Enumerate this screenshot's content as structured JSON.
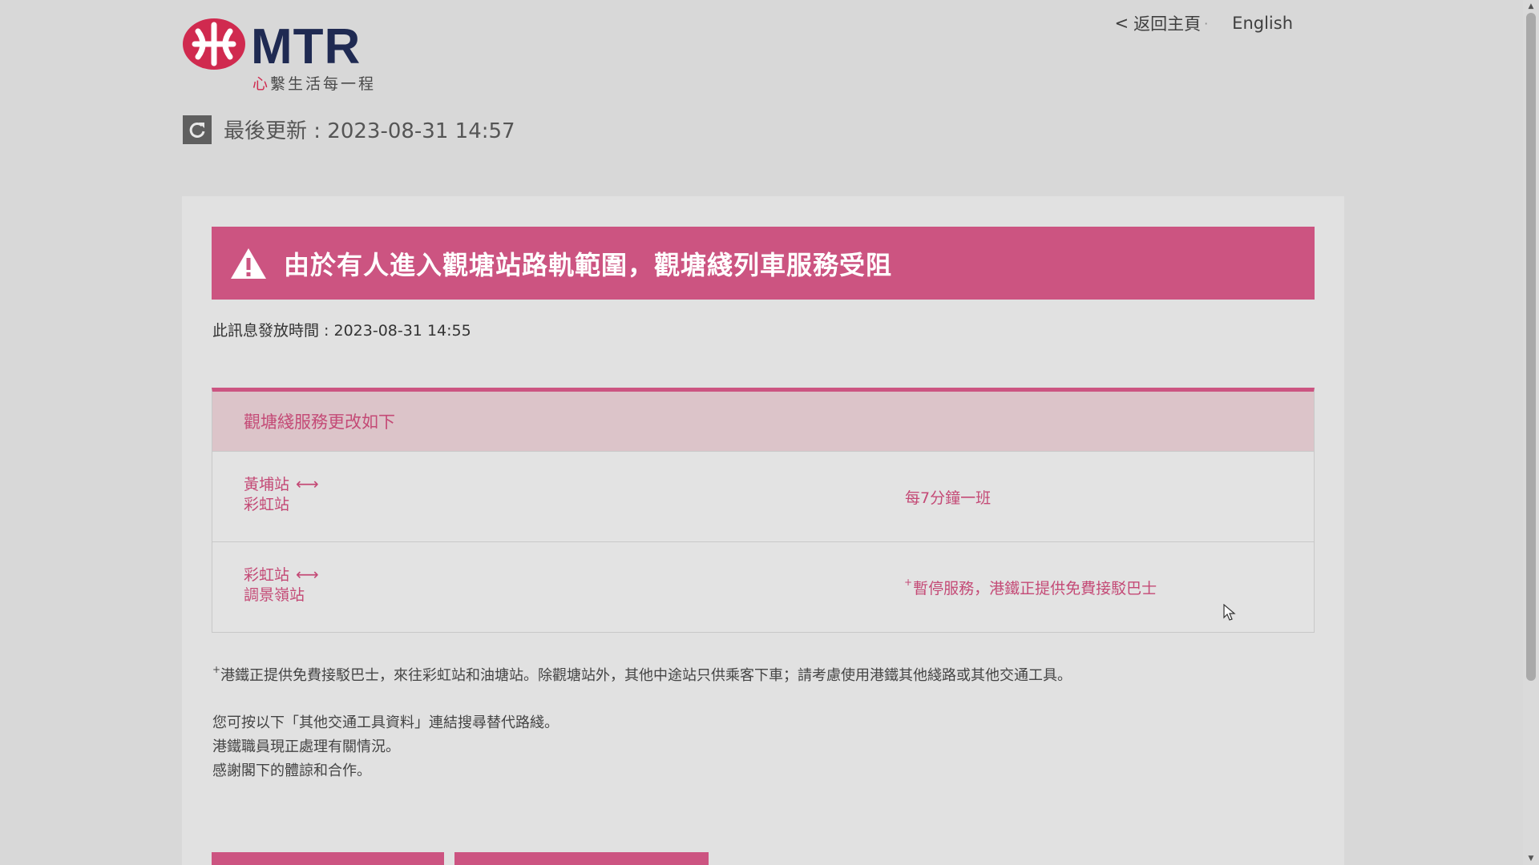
{
  "header": {
    "logo_word": "MTR",
    "slogan_first": "心",
    "slogan_rest": "繫生活每一程",
    "back_label": "返回主頁",
    "back_chevron": "<",
    "separator": "·",
    "lang_label": "English",
    "last_updated": "最後更新 : 2023-08-31 14:57"
  },
  "alert": {
    "title": "由於有人進入觀塘站路軌範圍，觀塘綫列車服務受阻",
    "issued": "此訊息發放時間 : 2023-08-31 14:55"
  },
  "service_table": {
    "header": "觀塘綫服務更改如下",
    "rows": [
      {
        "from": "黃埔站",
        "to": "彩虹站",
        "arrow": "⟷",
        "note_mark": "",
        "note": "每7分鐘一班"
      },
      {
        "from": "彩虹站",
        "to": "調景嶺站",
        "arrow": "⟷",
        "note_mark": "+",
        "note": "暫停服務，港鐵正提供免費接駁巴士"
      }
    ]
  },
  "footnote": {
    "mark": "+",
    "text": "港鐵正提供免費接駁巴士，來往彩虹站和油塘站。除觀塘站外，其他中途站只供乘客下車；請考慮使用港鐵其他綫路或其他交通工具。"
  },
  "info_lines": [
    "您可按以下「其他交通工具資料」連結搜尋替代路綫。",
    "港鐵職員現正處理有關情況。",
    "感謝閣下的體諒和合作。"
  ],
  "colors": {
    "accent": "#cc5481",
    "accent_text": "#c44a76",
    "brand_red": "#d02a4f",
    "brand_navy": "#1f2a52"
  },
  "icons": {
    "logo": "mtr-logo-icon",
    "refresh": "refresh-icon",
    "warning": "warning-icon",
    "cursor": "mouse-cursor-icon"
  }
}
